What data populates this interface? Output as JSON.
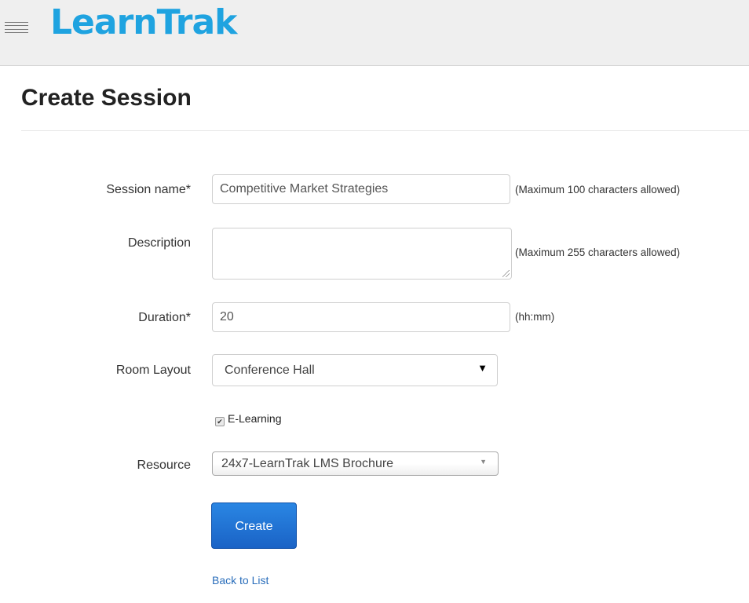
{
  "header": {
    "menu_icon": "hamburger-menu-icon",
    "logo_text": "LearnTrak",
    "logo_color": "#1fa3e0"
  },
  "page": {
    "title": "Create Session"
  },
  "form": {
    "session_name": {
      "label": "Session name*",
      "value": "Competitive Market Strategies",
      "hint": "(Maximum 100 characters allowed)"
    },
    "description": {
      "label": "Description",
      "value": "",
      "hint": "(Maximum 255 characters allowed)"
    },
    "duration": {
      "label": "Duration*",
      "value": "20",
      "hint": "(hh:mm)"
    },
    "room_layout": {
      "label": "Room Layout",
      "selected": "Conference Hall"
    },
    "elearning": {
      "label": "E-Learning",
      "checked": true
    },
    "resource": {
      "label": "Resource",
      "selected": "24x7-LearnTrak LMS Brochure"
    },
    "create_label": "Create",
    "back_label": "Back to List"
  },
  "colors": {
    "primary_button": "#1a63c6",
    "link": "#2a6ebb",
    "header_bg": "#efefef"
  }
}
